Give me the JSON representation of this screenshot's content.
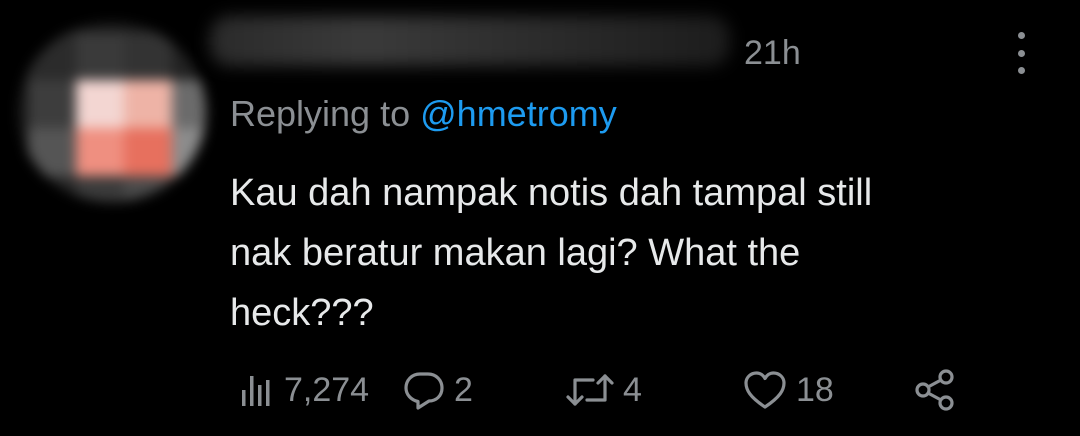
{
  "tweet": {
    "timestamp": "21h",
    "replying_prefix": "Replying to",
    "replying_handle": "@hmetromy",
    "body_lines": [
      "Kau dah nampak notis dah tampal still",
      "nak beratur makan lagi? What the",
      "heck???"
    ]
  },
  "actions": {
    "views": "7,274",
    "replies": "2",
    "retweets": "4",
    "likes": "18"
  },
  "icons": {
    "views": "analytics-icon",
    "reply": "reply-bubble-icon",
    "retweet": "retweet-icon",
    "like": "heart-icon",
    "share": "share-icon",
    "more": "more-vertical-icon"
  },
  "colors": {
    "background": "#000000",
    "text": "#e7e9ea",
    "muted": "#8b8f93",
    "link": "#1d9bf0"
  }
}
